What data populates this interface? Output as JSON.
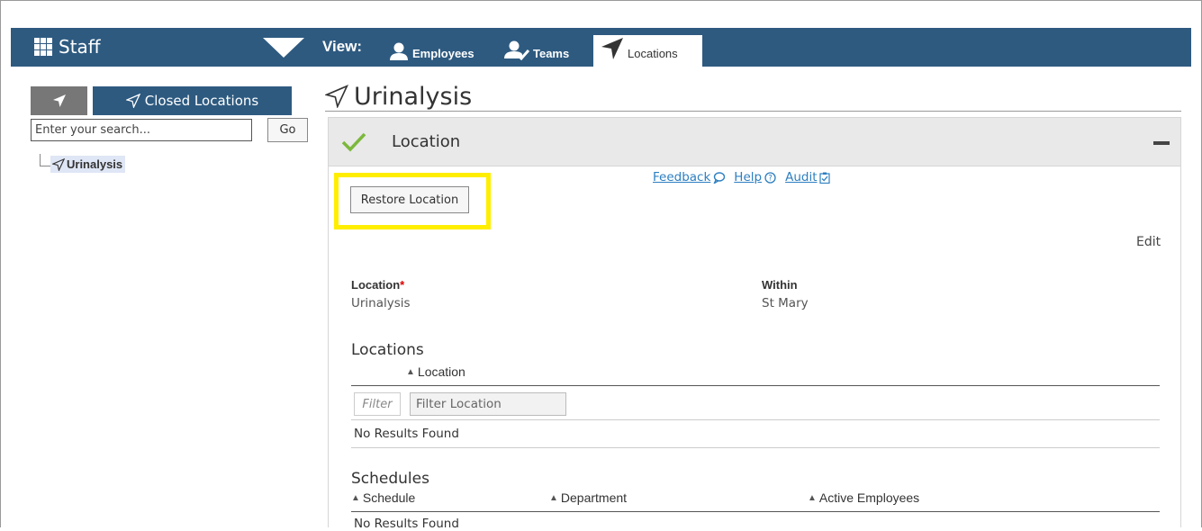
{
  "app": {
    "title": "Staff"
  },
  "nav": {
    "view_label": "View:",
    "tabs": [
      {
        "label": "Employees",
        "icon": "person-icon"
      },
      {
        "label": "Teams",
        "icon": "team-icon"
      },
      {
        "label": "Locations",
        "icon": "location-arrow-icon",
        "active": true
      }
    ]
  },
  "sidebar": {
    "closed_tab_label": "Closed Locations",
    "search_placeholder": "Enter your search...",
    "go_label": "Go",
    "tree": [
      {
        "label": "Urinalysis",
        "selected": true
      }
    ]
  },
  "page": {
    "title": "Urinalysis"
  },
  "section": {
    "title": "Location",
    "links": {
      "feedback": "Feedback",
      "help": "Help",
      "audit": "Audit"
    },
    "restore_label": "Restore Location",
    "edit_label": "Edit",
    "fields": {
      "location_label": "Location",
      "location_required": "*",
      "location_value": "Urinalysis",
      "within_label": "Within",
      "within_value": "St Mary"
    }
  },
  "locations": {
    "heading": "Locations",
    "columns": [
      "Location"
    ],
    "filter_tag": "Filter",
    "filter_placeholder": "Filter Location",
    "empty": "No Results Found"
  },
  "schedules": {
    "heading": "Schedules",
    "columns": [
      "Schedule",
      "Department",
      "Active Employees"
    ],
    "empty": "No Results Found"
  },
  "colors": {
    "nav_bg": "#2e5a80",
    "highlight": "#ffee00",
    "check": "#7cb83c",
    "link": "#2d7fc1",
    "required": "#dd0000"
  }
}
